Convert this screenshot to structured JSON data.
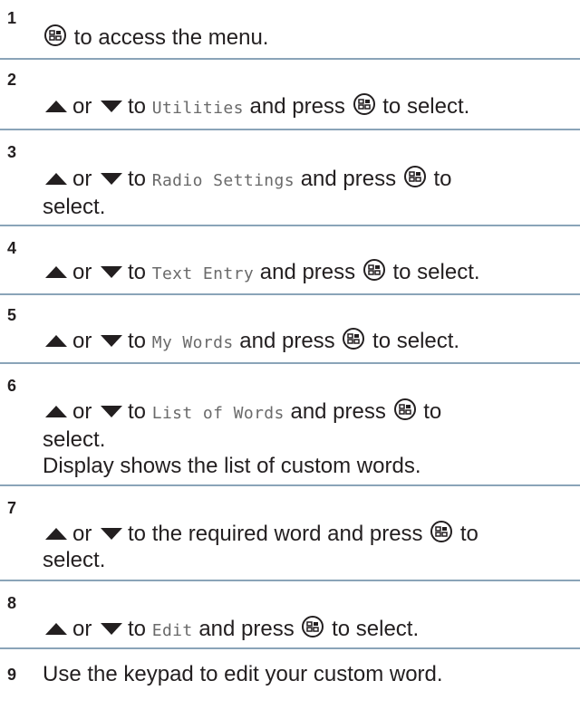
{
  "steps": [
    {
      "num": "1",
      "pre": "",
      "nav_or": "",
      "nav_to": "",
      "target": "",
      "after": "",
      "action": "to access the menu.",
      "cont": "",
      "note": ""
    },
    {
      "num": "2",
      "nav_or": "or",
      "nav_to": "to",
      "target": "Utilities",
      "after": "and press",
      "action": "to select.",
      "cont": "",
      "note": ""
    },
    {
      "num": "3",
      "nav_or": "or",
      "nav_to": "to",
      "target": "Radio Settings",
      "after": "and press",
      "action": "to",
      "cont": "select.",
      "note": ""
    },
    {
      "num": "4",
      "nav_or": "or",
      "nav_to": "to",
      "target": "Text Entry",
      "after": "and press",
      "action": "to select.",
      "cont": "",
      "note": ""
    },
    {
      "num": "5",
      "nav_or": "or",
      "nav_to": "to",
      "target": "My Words",
      "after": "and press",
      "action": "to select.",
      "cont": "",
      "note": ""
    },
    {
      "num": "6",
      "nav_or": "or",
      "nav_to": "to",
      "target": "List of Words",
      "after": "and press",
      "action": "to",
      "cont": "select.",
      "note": "Display shows the list of custom words."
    },
    {
      "num": "7",
      "nav_or": "or",
      "nav_to": "to the required word and press",
      "target": "",
      "after": "",
      "action": "to",
      "cont": "select.",
      "note": ""
    },
    {
      "num": "8",
      "nav_or": "or",
      "nav_to": "to",
      "target": "Edit",
      "after": "and press",
      "action": "to select.",
      "cont": "",
      "note": ""
    },
    {
      "num": "9",
      "text": "Use the keypad to edit your custom word."
    }
  ],
  "icons": {
    "ok_button": "menu-ok-button-icon",
    "up": "up-arrow-icon",
    "down": "down-arrow-icon"
  }
}
